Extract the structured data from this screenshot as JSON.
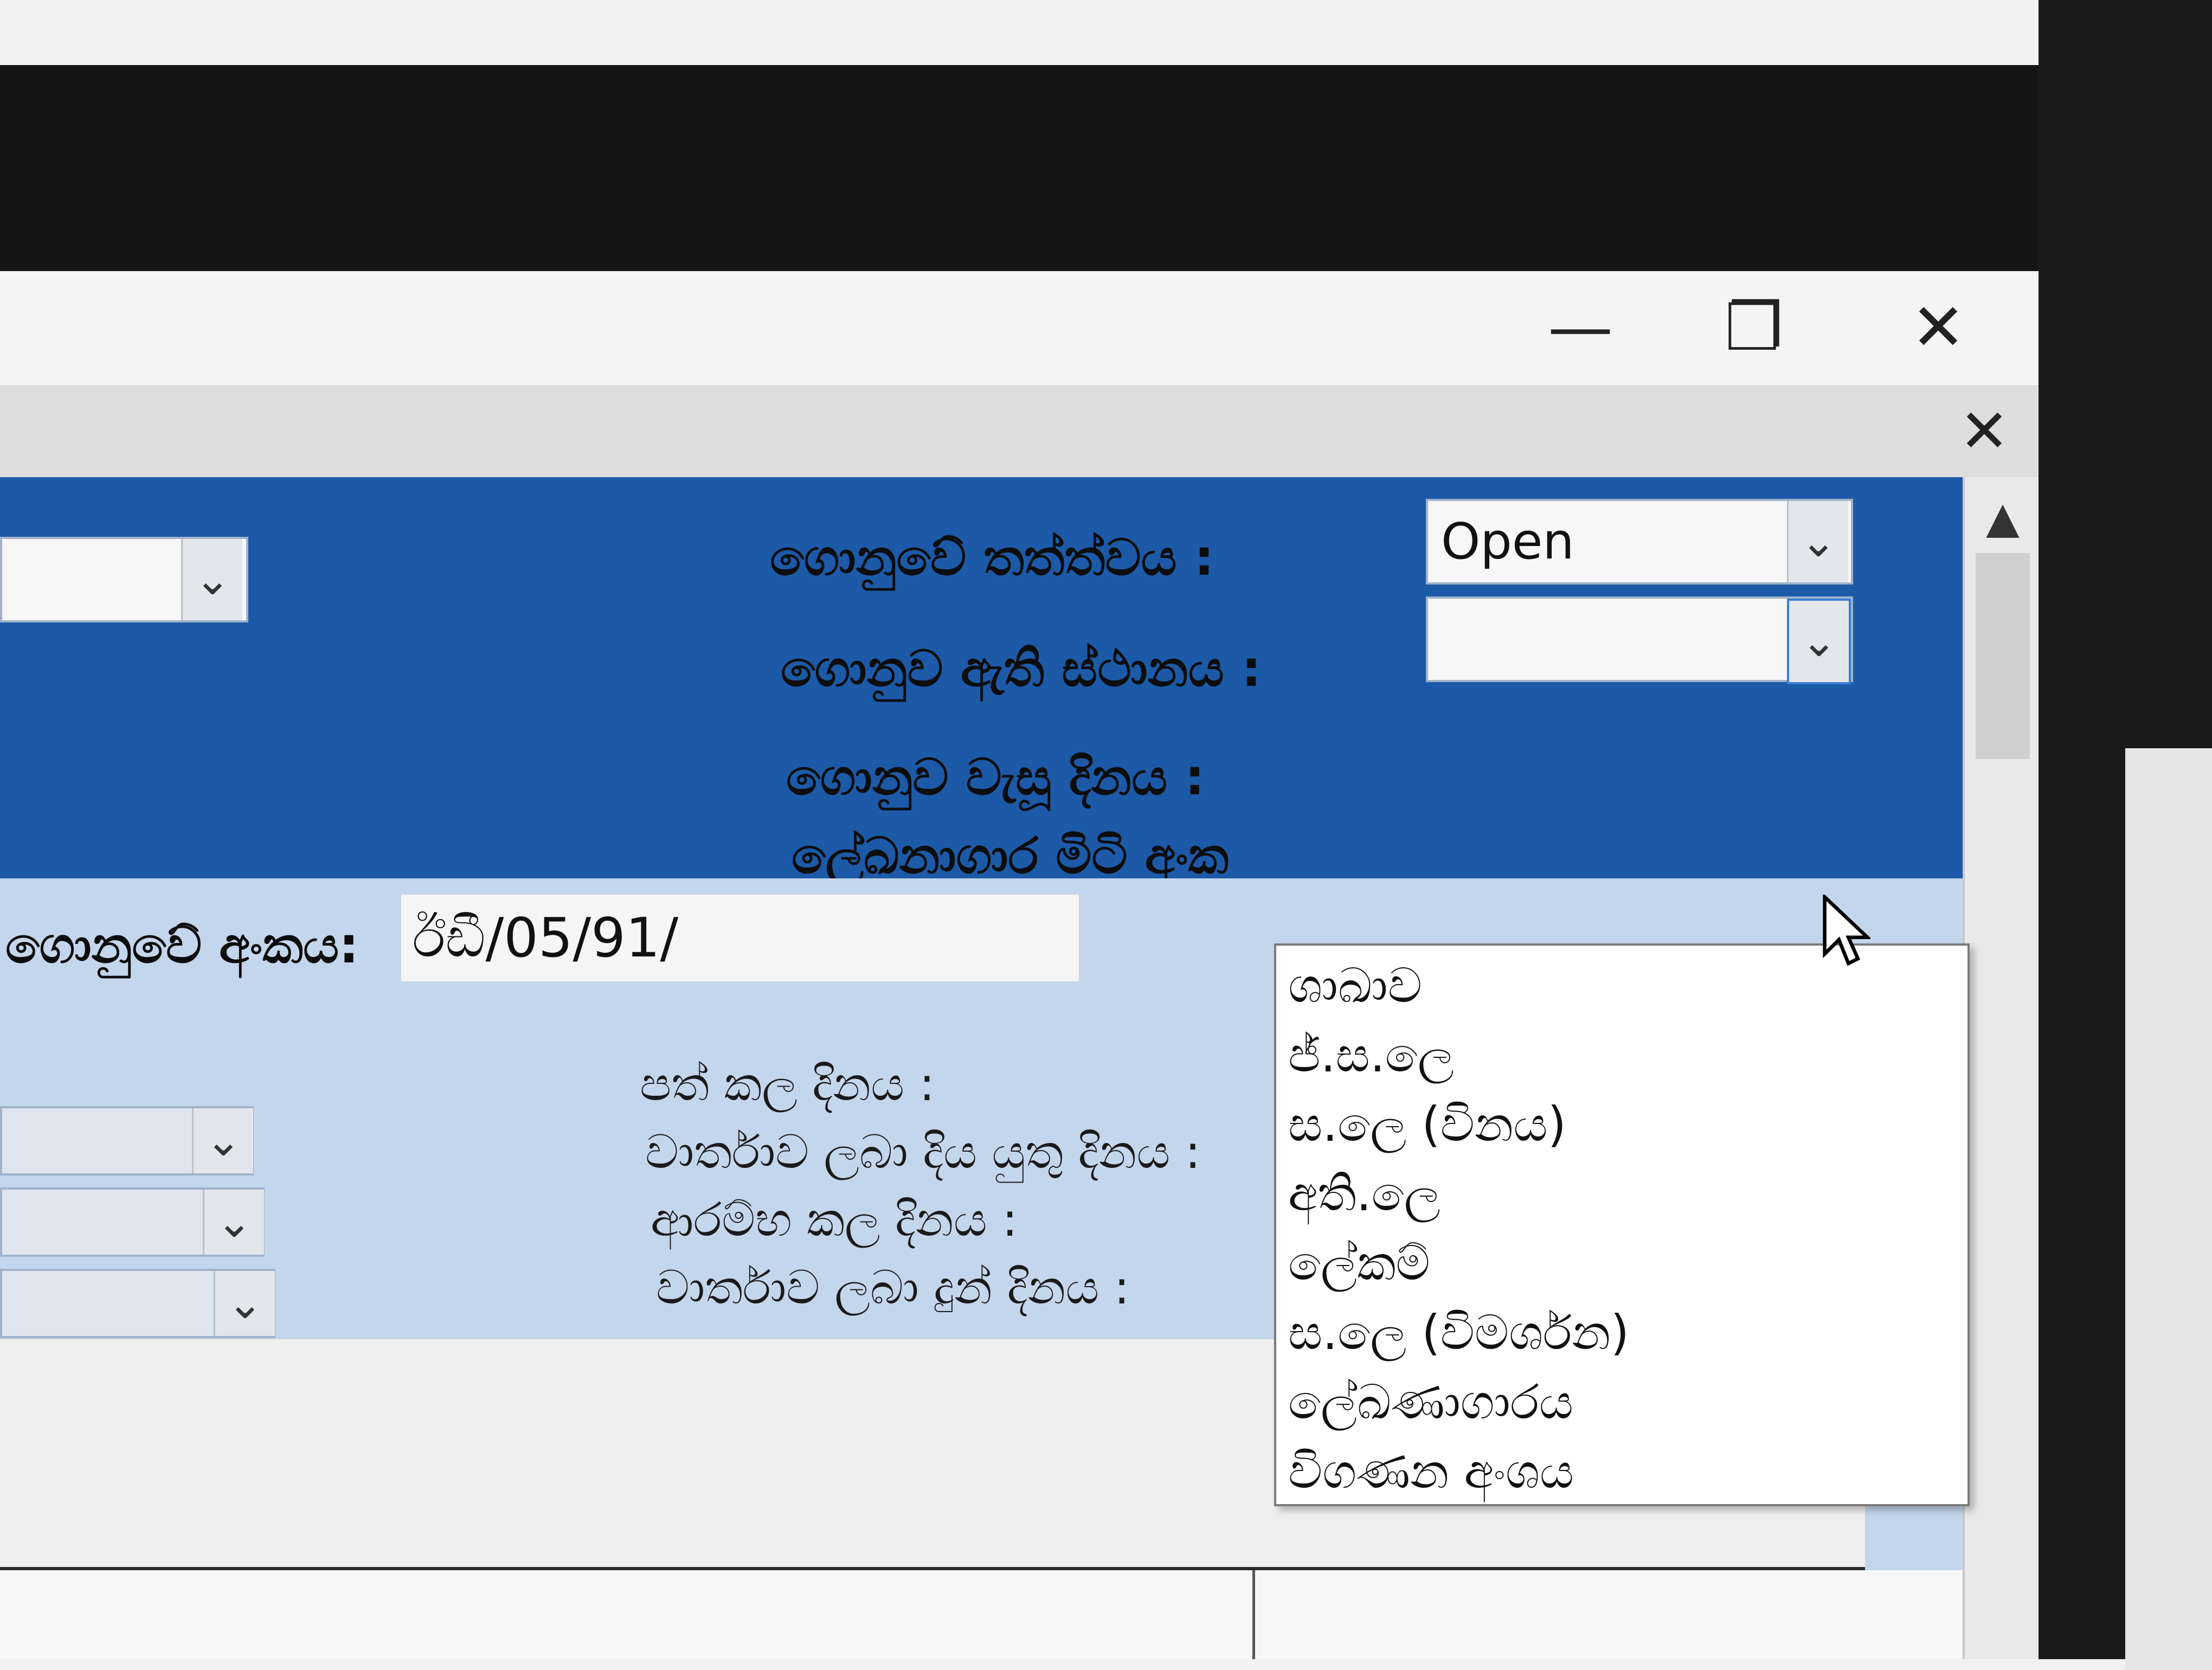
{
  "window": {
    "minimize_glyph": "—",
    "restore_glyph": "❐",
    "close_glyph": "✕",
    "mdi_close_glyph": "✕"
  },
  "form": {
    "status_label": "ගොනුවේ තත්ත්වය :",
    "status_value": "Open",
    "location_label": "ගොනුව ඇති ස්ථානය :",
    "location_value": "",
    "closed_date_label": "ගොනුව වැසූ දිනය :",
    "archive_label": "ලේඛනාගාර මිටි අංක",
    "file_number_label": "ගොනුවේ අංකය:",
    "file_number_value": "ඊඩී/05/91/",
    "assigned_date_label": "පත් කල දිනය :",
    "report_due_label": "වාර්තාව ලබා දිය යුතු දිනය :",
    "started_date_label": "ආරම්භ කල දිනය :",
    "report_given_label": "වාර්තාව ලබා දුන් දිනය :"
  },
  "dropdown": {
    "options": [
      "ශාඛාව",
      "ජ්.ස.ලෙ",
      "ස.ලෙ (විනය)",
      "අති.ලෙ",
      "ලේකම්",
      "ස.ලෙ (විමර්ශන)",
      "ලේඛණාගාරය",
      "විගණන අංශය"
    ]
  },
  "colors": {
    "panel_top": "#1c5aa8",
    "panel_bottom": "#c4d6ec"
  },
  "icons": {
    "chevron": "chevron-down-icon",
    "scroll_up": "scroll-up-arrow-icon",
    "cursor": "mouse-pointer-icon"
  }
}
